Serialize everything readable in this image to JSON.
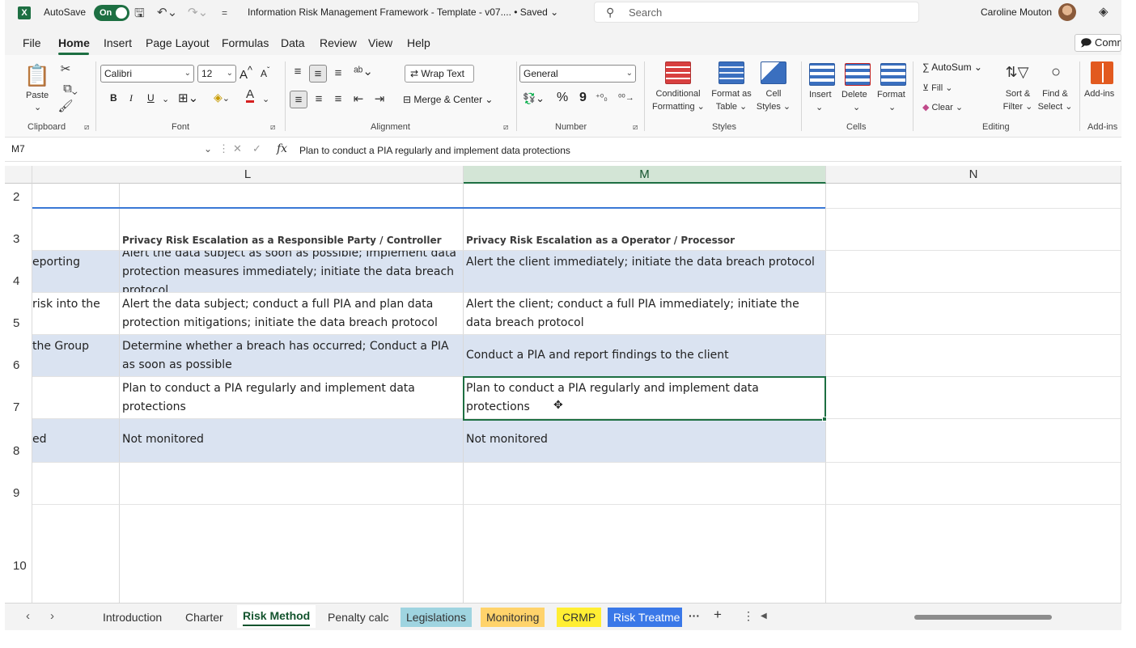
{
  "titlebar": {
    "autosave_label": "AutoSave",
    "autosave_state": "On",
    "document_title": "Information Risk Management Framework - Template -  v07.... • Saved ⌄",
    "search_placeholder": "Search",
    "user_name": "Caroline Mouton"
  },
  "menu": {
    "tabs": [
      "File",
      "Home",
      "Insert",
      "Page Layout",
      "Formulas",
      "Data",
      "Review",
      "View",
      "Help"
    ],
    "active": "Home",
    "comments_label": "Comments"
  },
  "ribbon": {
    "clipboard": {
      "paste_label": "Paste",
      "group_label": "Clipboard"
    },
    "font": {
      "name": "Calibri",
      "size": "12",
      "group_label": "Font",
      "bold": "B",
      "italic": "I",
      "underline": "U"
    },
    "alignment": {
      "wrap_text": "Wrap Text",
      "merge_center": "Merge & Center",
      "group_label": "Alignment"
    },
    "number": {
      "format": "General",
      "group_label": "Number",
      "percent": "%",
      "comma": "9"
    },
    "styles": {
      "conditional_formatting": [
        "Conditional",
        "Formatting ⌄"
      ],
      "format_as_table": [
        "Format as",
        "Table ⌄"
      ],
      "cell_styles": [
        "Cell",
        "Styles ⌄"
      ],
      "group_label": "Styles"
    },
    "cells": {
      "insert": "Insert",
      "delete": "Delete",
      "format": "Format",
      "group_label": "Cells"
    },
    "editing": {
      "autosum": "AutoSum",
      "fill": "Fill ⌄",
      "clear": "Clear ⌄",
      "sort_filter": [
        "Sort &",
        "Filter ⌄"
      ],
      "find_select": [
        "Find &",
        "Select ⌄"
      ],
      "group_label": "Editing"
    },
    "addins": {
      "label": "Add-ins",
      "group_label": "Add-ins"
    }
  },
  "formula_bar": {
    "name_box": "M7",
    "formula": "Plan to conduct a PIA regularly and implement data protections"
  },
  "grid": {
    "columns": [
      "L",
      "M",
      "N"
    ],
    "selected_column": "M",
    "rows": [
      "2",
      "3",
      "4",
      "5",
      "6",
      "7",
      "8",
      "9",
      "10"
    ],
    "k_fragments": {
      "r4": "eporting",
      "r5": "risk into the",
      "r6": "the Group",
      "r8": "ed"
    },
    "header_L": "Privacy Risk Escalation as a Responsible Party / Controller",
    "header_M": "Privacy Risk Escalation as a Operator / Processor",
    "l4": "Alert the data subject as soon as possible;  Implement data protection measures immediately; initiate the data breach protocol",
    "m4": "Alert the client immediately;  initiate the data breach protocol",
    "l5": "Alert the data subject; conduct a full PIA and plan data protection mitigations; initiate the data breach protocol",
    "m5": "Alert the client; conduct a full PIA immediately; initiate the data breach protocol",
    "l6": "Determine whether a breach has occurred; Conduct a PIA as soon as possible",
    "m6": "Conduct a PIA and report findings to the client",
    "l7": "Plan to conduct a PIA regularly and implement data protections",
    "m7": "Plan to conduct a PIA regularly and implement data protections",
    "l8": "Not monitored",
    "m8": "Not monitored",
    "selected_cell": "M7"
  },
  "sheets": {
    "tabs": [
      {
        "label": "Introduction",
        "color": ""
      },
      {
        "label": "Charter",
        "color": ""
      },
      {
        "label": "Risk Method",
        "color": ""
      },
      {
        "label": "Penalty calc",
        "color": ""
      },
      {
        "label": "Legislations",
        "color": "#9fd4e0"
      },
      {
        "label": "Monitoring",
        "color": "#ffd36b"
      },
      {
        "label": "CRMP",
        "color": "#ffee33"
      },
      {
        "label": "Risk Treatme",
        "color": "#3a78e8"
      }
    ],
    "active": "Risk Method"
  }
}
